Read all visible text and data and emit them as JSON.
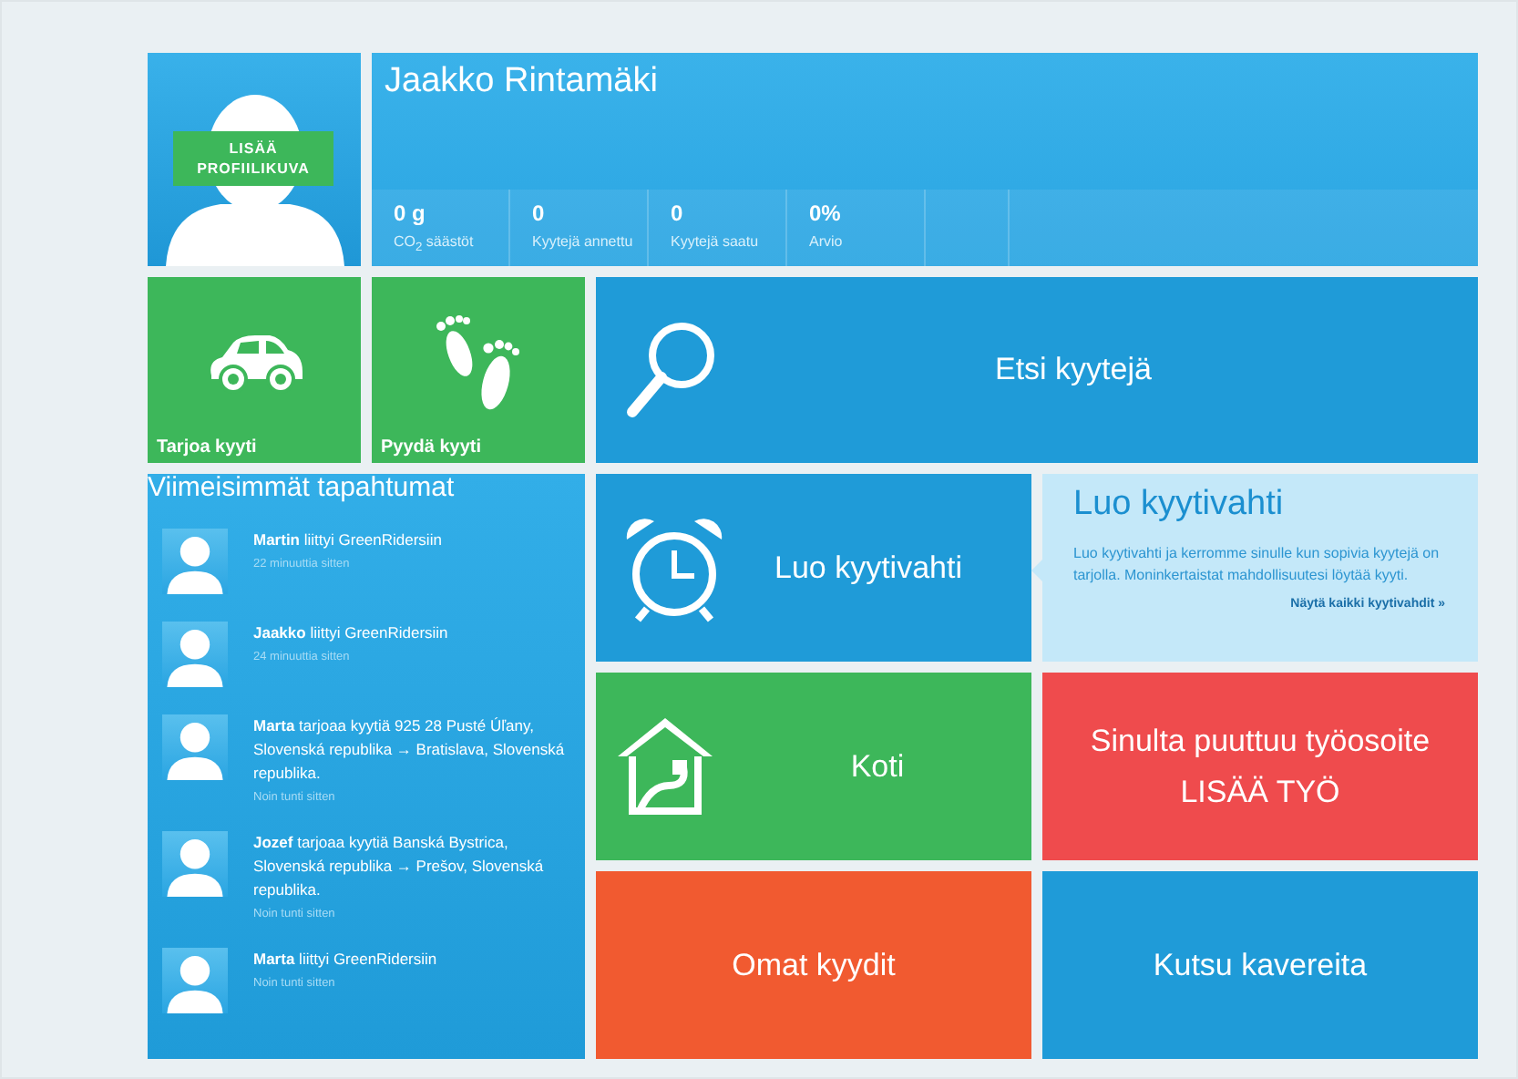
{
  "profile": {
    "add_photo": "LISÄÄ PROFIILIKUVA",
    "name": "Jaakko Rintamäki"
  },
  "stats": [
    {
      "value": "0 g",
      "label": "CO$_{2}$ säästöt"
    },
    {
      "value": "0",
      "label": "Kyytejä annettu"
    },
    {
      "value": "0",
      "label": "Kyytejä saatu"
    },
    {
      "value": "0%",
      "label": "Arvio"
    }
  ],
  "tiles": [
    {
      "kind": "car",
      "color": "#3db75a",
      "lines": [
        "Tarjoa kyyti"
      ]
    },
    {
      "kind": "feet",
      "color": "#3db75a",
      "lines": [
        "Pyydä kyyti"
      ]
    },
    {
      "kind": "search",
      "color": "#1f9bd8",
      "lines": [
        "Etsi kyytejä"
      ]
    },
    {
      "kind": "alarm",
      "color": "#1f9bd8",
      "lines": [
        "Luo kyytivahti"
      ]
    },
    {
      "kind": "house",
      "color": "#3db75a",
      "lines": [
        "Koti"
      ]
    },
    {
      "kind": "text",
      "color": "#ef4b4d",
      "lines": [
        "Sinulta puuttuu työosoite",
        "LISÄÄ TYÖ"
      ]
    },
    {
      "kind": "text",
      "color": "#f15a30",
      "lines": [
        "Omat kyydit"
      ]
    },
    {
      "kind": "text",
      "color": "#1f9bd8",
      "lines": [
        "Kutsu kavereita"
      ]
    }
  ],
  "alert_info": {
    "title": "Luo kyytivahti",
    "text": "Luo kyytivahti ja kerromme sinulle kun sopivia kyytejä on tarjolla. Moninkertaistat mahdollisuutesi löytää kyyti.",
    "link": "Näytä kaikki kyytivahdit »"
  },
  "events": {
    "title": "Viimeisimmät tapahtumat",
    "items": [
      {
        "text": "**Martin** liittyi GreenRidersiin",
        "time": "22 minuuttia sitten"
      },
      {
        "text": "**Jaakko** liittyi GreenRidersiin",
        "time": "24 minuuttia sitten"
      },
      {
        "text": "**Marta** tarjoaa kyytiä 925 28 Pusté Úľany, Slovenská republika → Bratislava, Slovenská republika.",
        "time": "Noin tunti sitten"
      },
      {
        "text": "**Jozef** tarjoaa kyytiä Banská Bystrica, Slovenská republika → Prešov, Slovenská republika.",
        "time": "Noin tunti sitten"
      },
      {
        "text": "**Marta** liittyi GreenRidersiin",
        "time": "Noin tunti sitten"
      }
    ]
  }
}
